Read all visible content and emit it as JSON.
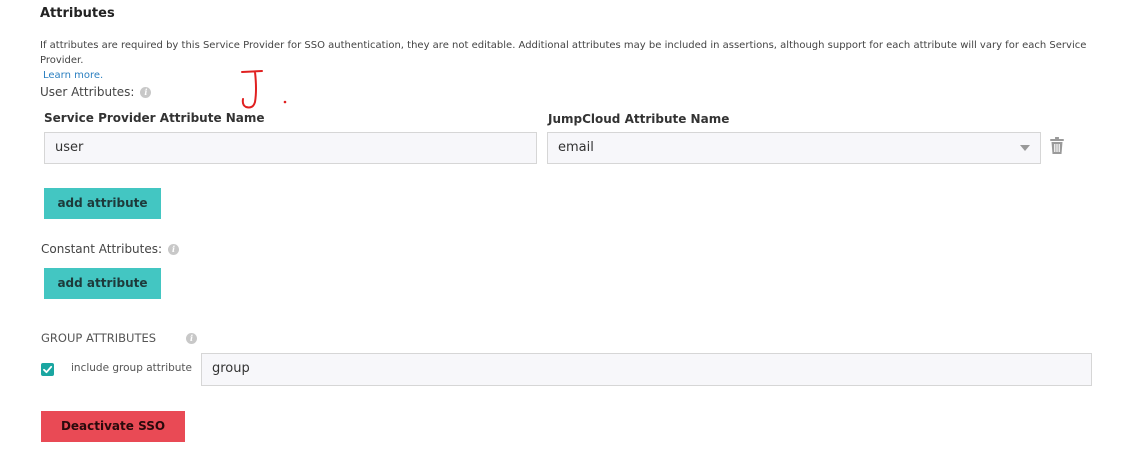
{
  "section": {
    "title": "Attributes",
    "description": "If attributes are required by this Service Provider for SSO authentication, they are not editable. Additional attributes may be included in assertions, although support for each attribute will vary for each Service Provider.",
    "learn_more": "Learn more."
  },
  "annotation": "J.",
  "user_attributes": {
    "label": "User Attributes:",
    "sp_header": "Service Provider Attribute Name",
    "jc_header": "JumpCloud Attribute Name",
    "sp_value": "user",
    "jc_value": "email",
    "add_label": "add attribute"
  },
  "constant_attributes": {
    "label": "Constant Attributes:",
    "add_label": "add attribute"
  },
  "group_attributes": {
    "label": "GROUP ATTRIBUTES",
    "checkbox_label": "include group attribute",
    "checked": true,
    "value": "group"
  },
  "deactivate_label": "Deactivate SSO",
  "colors": {
    "teal_button": "#43c6c2",
    "red_button": "#e94a55",
    "checkbox": "#1aa6a1",
    "link": "#2a7fc0",
    "annotation": "#e02020"
  },
  "icons": {
    "info": "info-icon",
    "trash": "trash-icon",
    "dropdown": "chevron-down-icon",
    "check": "checkmark-icon"
  }
}
